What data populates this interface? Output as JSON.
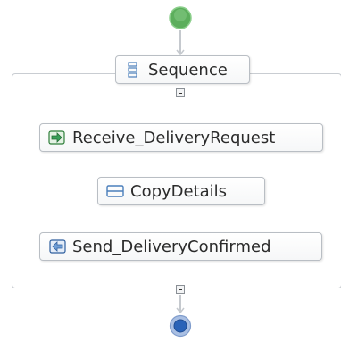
{
  "diagram": {
    "start_event": {
      "icon": "start-circle-icon",
      "color": "#5fb35f"
    },
    "end_event": {
      "icon": "end-circle-icon",
      "color": "#2a63b8"
    },
    "sequence": {
      "label": "Sequence",
      "icon": "sequence-icon"
    },
    "activities": [
      {
        "label": "Receive_DeliveryRequest",
        "icon": "receive-arrow-icon"
      },
      {
        "label": "CopyDetails",
        "icon": "assign-icon"
      },
      {
        "label": "Send_DeliveryConfirmed",
        "icon": "send-arrow-icon"
      }
    ],
    "colors": {
      "connector": "#b9bec4",
      "node_border": "#b9bec4",
      "icon_blue": "#4a7ebb",
      "icon_green": "#3aa05a"
    }
  }
}
